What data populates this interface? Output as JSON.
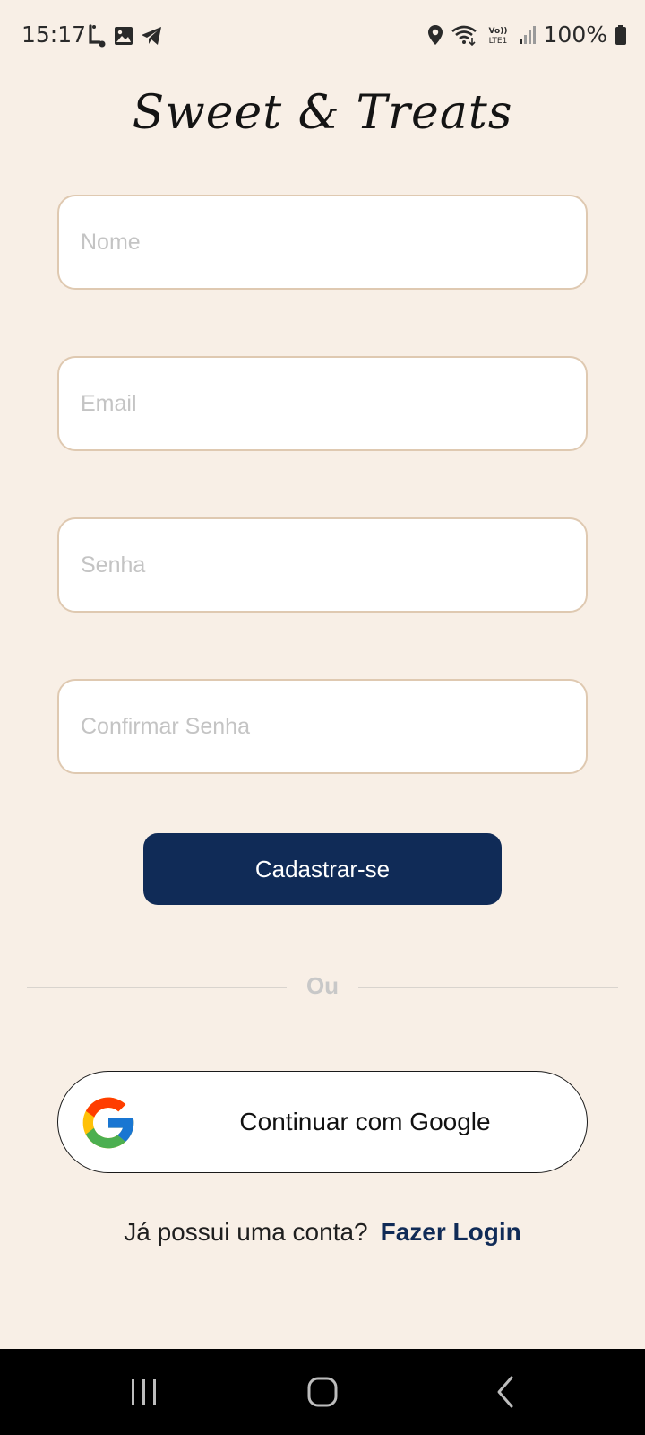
{
  "status_bar": {
    "time": "15:17",
    "battery": "100%",
    "left_icons": [
      "usb-debug-icon",
      "gallery-icon",
      "telegram-icon"
    ],
    "right_icons": [
      "location-icon",
      "wifi-icon",
      "volte-icon",
      "signal-icon",
      "battery-icon"
    ]
  },
  "app": {
    "logo": "Sweet & Treats"
  },
  "form": {
    "name_placeholder": "Nome",
    "email_placeholder": "Email",
    "password_placeholder": "Senha",
    "confirm_placeholder": "Confirmar Senha",
    "submit_label": "Cadastrar-se"
  },
  "divider": {
    "text": "Ou"
  },
  "google": {
    "label": "Continuar com Google",
    "icon": "google-icon"
  },
  "login": {
    "prompt": "Já possui uma conta?",
    "link": "Fazer Login"
  },
  "nav": {
    "icons": [
      "recents-icon",
      "home-icon",
      "back-icon"
    ]
  },
  "colors": {
    "background": "#f8efe6",
    "primary": "#102b57",
    "field_border": "#dfc9b1",
    "placeholder": "#c4c4c4"
  }
}
